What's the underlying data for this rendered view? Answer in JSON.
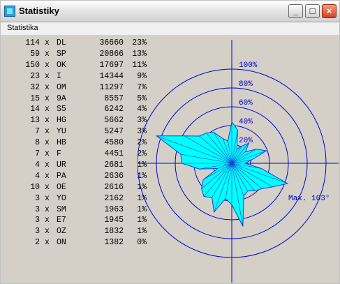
{
  "window": {
    "title": "Statistiky"
  },
  "menu": {
    "items": [
      {
        "label": "Statistika"
      }
    ]
  },
  "stats": {
    "rows": [
      {
        "count": "114",
        "x": "x",
        "call": "DL",
        "dist": "36660",
        "pct": "23%"
      },
      {
        "count": "59",
        "x": "x",
        "call": "SP",
        "dist": "20866",
        "pct": "13%"
      },
      {
        "count": "150",
        "x": "x",
        "call": "OK",
        "dist": "17697",
        "pct": "11%"
      },
      {
        "count": "23",
        "x": "x",
        "call": "I",
        "dist": "14344",
        "pct": "9%"
      },
      {
        "count": "32",
        "x": "x",
        "call": "OM",
        "dist": "11297",
        "pct": "7%"
      },
      {
        "count": "15",
        "x": "x",
        "call": "9A",
        "dist": "8557",
        "pct": "5%"
      },
      {
        "count": "14",
        "x": "x",
        "call": "S5",
        "dist": "6242",
        "pct": "4%"
      },
      {
        "count": "13",
        "x": "x",
        "call": "HG",
        "dist": "5662",
        "pct": "3%"
      },
      {
        "count": "7",
        "x": "x",
        "call": "YU",
        "dist": "5247",
        "pct": "3%"
      },
      {
        "count": "8",
        "x": "x",
        "call": "HB",
        "dist": "4580",
        "pct": "2%"
      },
      {
        "count": "7",
        "x": "x",
        "call": "F",
        "dist": "4451",
        "pct": "2%"
      },
      {
        "count": "4",
        "x": "x",
        "call": "UR",
        "dist": "2681",
        "pct": "1%"
      },
      {
        "count": "4",
        "x": "x",
        "call": "PA",
        "dist": "2636",
        "pct": "1%"
      },
      {
        "count": "10",
        "x": "x",
        "call": "OE",
        "dist": "2616",
        "pct": "1%"
      },
      {
        "count": "3",
        "x": "x",
        "call": "YO",
        "dist": "2162",
        "pct": "1%"
      },
      {
        "count": "3",
        "x": "x",
        "call": "SM",
        "dist": "1963",
        "pct": "1%"
      },
      {
        "count": "3",
        "x": "x",
        "call": "E7",
        "dist": "1945",
        "pct": "1%"
      },
      {
        "count": "3",
        "x": "x",
        "call": "OZ",
        "dist": "1832",
        "pct": "1%"
      },
      {
        "count": "2",
        "x": "x",
        "call": "ON",
        "dist": "1382",
        "pct": "0%"
      }
    ]
  },
  "chart_data": {
    "type": "radar",
    "ring_labels": [
      "20%",
      "40%",
      "60%",
      "80%",
      "100%"
    ],
    "rings": [
      20,
      40,
      60,
      80,
      100
    ],
    "max_label": "Max. 103°",
    "max_bearing_deg": 103,
    "angle_step_deg": 10,
    "values": [
      44,
      36,
      16,
      21,
      28,
      19,
      30,
      39,
      22,
      14,
      32,
      63,
      50,
      42,
      38,
      34,
      37,
      68,
      44,
      38,
      55,
      42,
      46,
      42,
      35,
      16,
      35,
      53,
      55,
      85,
      58,
      45,
      42,
      38,
      28,
      24
    ],
    "colors": {
      "fill": "#00ffff",
      "outline": "#1f3fd0",
      "grid": "#0000cc",
      "label": "#0000cc"
    }
  }
}
